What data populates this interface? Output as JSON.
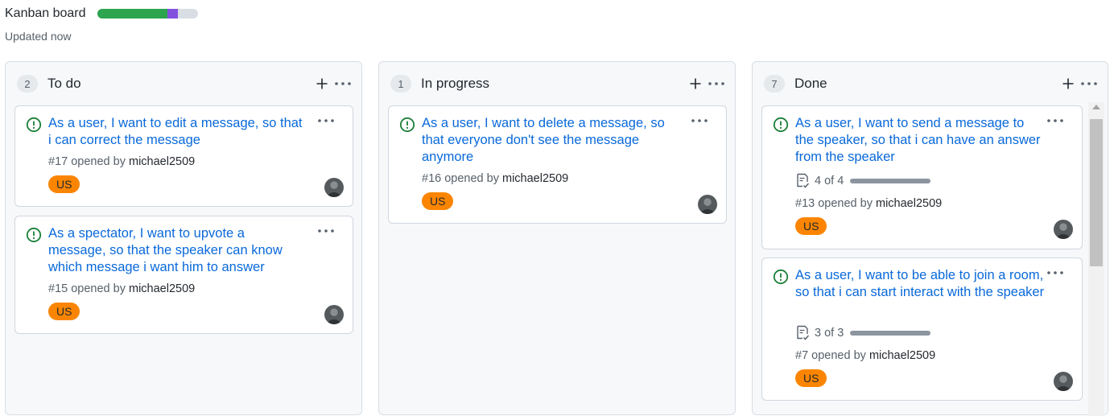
{
  "board": {
    "title": "Kanban board",
    "updated": "Updated now",
    "progress": {
      "done_fraction": 0.7,
      "in_progress_fraction": 0.1
    },
    "colors": {
      "done": "#2da44e",
      "in_progress": "#8250df",
      "remaining": "#d8dee4",
      "link": "#0969da",
      "label_us": "#fb8500",
      "open_issue": "#1a7f37"
    }
  },
  "columns": [
    {
      "count": "2",
      "name": "To do",
      "add_icon": "plus-icon",
      "menu_icon": "kebab-horizontal-icon",
      "cards": [
        {
          "title": "As a user, I want to edit a message, so that i can correct the message",
          "number": "#17",
          "opened_by": "opened by",
          "author": "michael2509",
          "label": "US"
        },
        {
          "title": "As a spectator, I want to upvote a message, so that the speaker can know which message i want him to answer",
          "number": "#15",
          "opened_by": "opened by",
          "author": "michael2509",
          "label": "US"
        }
      ]
    },
    {
      "count": "1",
      "name": "In progress",
      "add_icon": "plus-icon",
      "menu_icon": "kebab-horizontal-icon",
      "cards": [
        {
          "title": "As a user, I want to delete a message, so that everyone don't see the message anymore",
          "number": "#16",
          "opened_by": "opened by",
          "author": "michael2509",
          "label": "US"
        }
      ]
    },
    {
      "count": "7",
      "name": "Done",
      "add_icon": "plus-icon",
      "menu_icon": "kebab-horizontal-icon",
      "cards": [
        {
          "title": "As a user, I want to send a message to the speaker, so that i can have an answer from the speaker",
          "checklist": "4 of 4",
          "number": "#13",
          "opened_by": "opened by",
          "author": "michael2509",
          "label": "US"
        },
        {
          "title": "As a user, I want to be able to join a room, so that i can start interact with the speaker",
          "checklist": "3 of 3",
          "number": "#7",
          "opened_by": "opened by",
          "author": "michael2509",
          "label": "US"
        }
      ]
    }
  ]
}
